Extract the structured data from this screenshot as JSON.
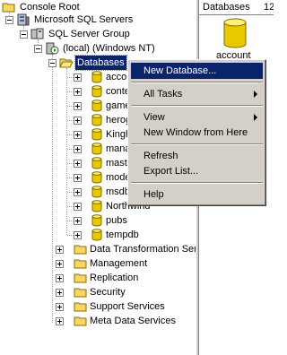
{
  "tree": {
    "console_root": "Console Root",
    "sql_servers": "Microsoft SQL Servers",
    "server_group": "SQL Server Group",
    "server": "(local) (Windows NT)",
    "databases_folder": "Databases",
    "databases": [
      "acco",
      "conte",
      "game",
      "herog",
      "Kingh",
      "mana",
      "maste",
      "mode",
      "msdb",
      "Northwind",
      "pubs",
      "tempdb"
    ],
    "folders": [
      "Data Transformation Ser",
      "Management",
      "Replication",
      "Security",
      "Support Services",
      "Meta Data Services"
    ]
  },
  "right_pane": {
    "header_title": "Databases",
    "header_count": "12",
    "item_label": "account"
  },
  "context_menu": {
    "items": [
      {
        "label": "New Database...",
        "highlighted": true
      },
      {
        "label": "All Tasks",
        "submenu": true
      },
      {
        "label": "View",
        "submenu": true
      },
      {
        "label": "New Window from Here"
      },
      {
        "label": "Refresh"
      },
      {
        "label": "Export List..."
      },
      {
        "label": "Help"
      }
    ]
  },
  "colors": {
    "selection": "#0a246a",
    "menu_bg": "#d4d0c8",
    "db_icon": "#e8c800"
  }
}
